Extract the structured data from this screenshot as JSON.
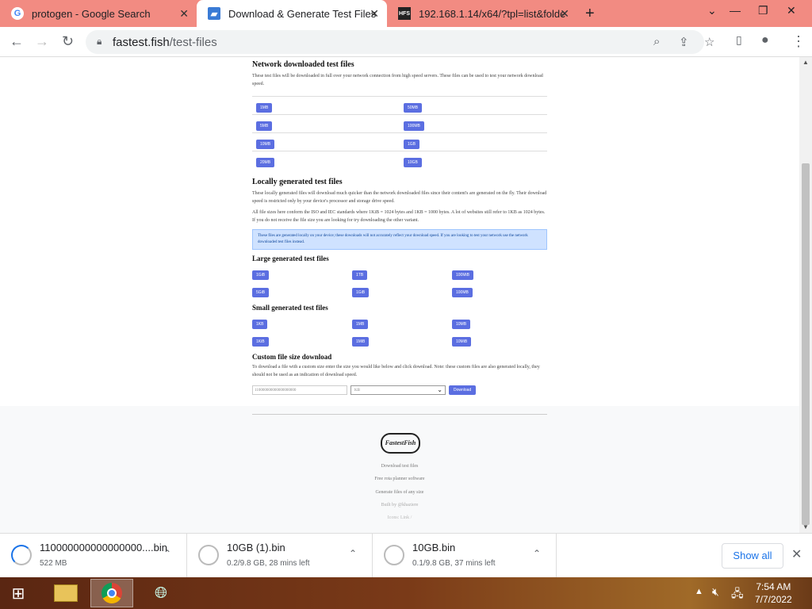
{
  "tabs": [
    {
      "title": "protogen - Google Search",
      "icon": "google-icon"
    },
    {
      "title": "Download & Generate Test Files",
      "icon": "site-icon"
    },
    {
      "title": "192.168.1.14/x64/?tpl=list&folde",
      "icon": "hfs-icon"
    }
  ],
  "address": {
    "host": "fastest.fish",
    "path": "/test-files"
  },
  "page": {
    "network": {
      "heading": "Network downloaded test files",
      "desc": "These test files will be downloaded in full over your network connection from high speed servers. These files can be used to test your network download speed.",
      "left": [
        "1MB",
        "5MB",
        "10MB",
        "20MB"
      ],
      "right": [
        "50MB",
        "100MB",
        "1GB",
        "10GB"
      ]
    },
    "local": {
      "heading": "Locally generated test files",
      "desc1": "These locally generated files will download much quicker than the network downloaded files since their content's are generated on the fly. Their download speed is restricted only by your device's processor and storage drive speed.",
      "desc2": "All file sizes here conform the ISO and IEC standards where 1KiB = 1024 bytes and 1KB = 1000 bytes. A lot of websites still refer to 1KB as 1024 bytes. If you do not receive the file size you are looking for try downloading the other variant.",
      "info": "These files are generated locally on your device; these downloads will not accurately reflect your download speed. If you are looking to test your network use the network downloaded test files instead."
    },
    "large": {
      "heading": "Large generated test files",
      "items": [
        "1GiB",
        "1TB",
        "100MiB",
        "5GiB",
        "1GiB",
        "100MB"
      ]
    },
    "small": {
      "heading": "Small generated test files",
      "items": [
        "1KB",
        "1MB",
        "10MB",
        "1KiB",
        "1MiB",
        "10MiB"
      ]
    },
    "custom": {
      "heading": "Custom file size download",
      "desc": "To download a file with a custom size enter the size you would like below and click download. Note: these custom files are also generated locally, they should not be used as an indication of download speed.",
      "value": "110000000000000000000",
      "unit": "KB",
      "button": "Download"
    },
    "footer": {
      "logo": "FastestFish",
      "links": [
        "Download test files",
        "Free rota planner software",
        "Generate files of any size"
      ],
      "built": "Built by @khaziere",
      "credit": "Icons: Link /"
    }
  },
  "downloads": [
    {
      "name": "110000000000000000....bin",
      "status": "522 MB"
    },
    {
      "name": "10GB (1).bin",
      "status": "0.2/9.8 GB, 28 mins left"
    },
    {
      "name": "10GB.bin",
      "status": "0.1/9.8 GB, 37 mins left"
    }
  ],
  "show_all": "Show all",
  "clock": {
    "time": "7:54 AM",
    "date": "7/7/2022"
  }
}
